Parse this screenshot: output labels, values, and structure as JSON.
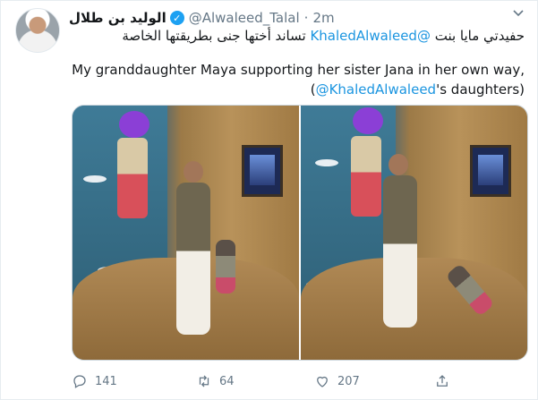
{
  "tweet": {
    "display_name": "الوليد بن طلال",
    "handle": "@Alwaleed_Talal",
    "separator": "·",
    "time": "2m",
    "menu_icon": "chevron-down-icon",
    "arabic_text_before": "حفيدتي مايا بنت ",
    "arabic_mention": "@KhaledAlwaleed",
    "arabic_text_after": " تساند أختها جنى بطريقتها الخاصة",
    "english_line1": "My granddaughter Maya supporting her sister Jana in her own way,",
    "english_line2_open": "(",
    "english_line2_mention": "@KhaledAlwaleed",
    "english_line2_rest": "'s daughters)"
  },
  "actions": {
    "reply_count": "141",
    "retweet_count": "64",
    "like_count": "207"
  },
  "colors": {
    "accent": "#1da1f2",
    "mention": "#1b95e0",
    "muted": "#657786"
  }
}
